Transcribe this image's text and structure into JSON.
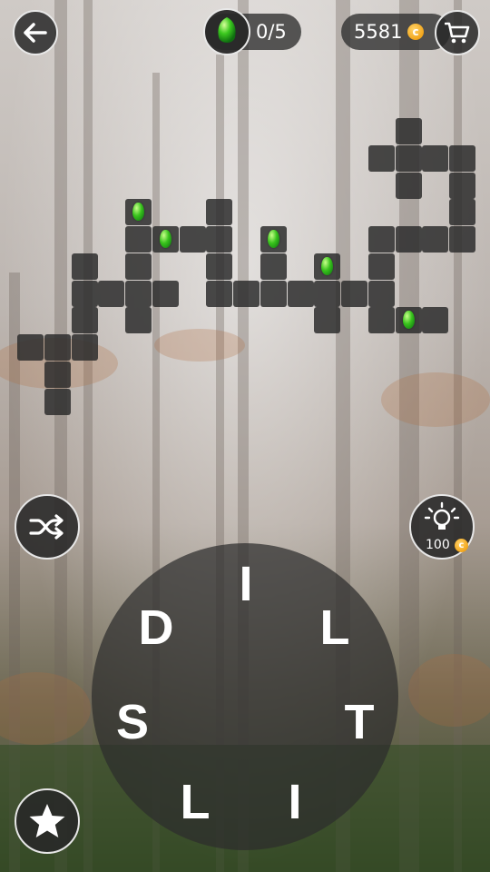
{
  "header": {
    "gems_collected": "0/5",
    "coins": "5581",
    "coin_symbol": "c"
  },
  "icons": {
    "back": "back-arrow-icon",
    "shop": "shopping-cart-icon",
    "gem": "green-gem-icon",
    "shuffle": "shuffle-icon",
    "hint": "lightbulb-icon",
    "star": "star-icon"
  },
  "hint": {
    "cost": "100"
  },
  "wheel": {
    "letters": [
      "I",
      "L",
      "T",
      "I",
      "L",
      "S",
      "D"
    ]
  },
  "colors": {
    "tile": "#2d2d2d",
    "gem": "#38c21c",
    "coin": "#f2a51a"
  }
}
